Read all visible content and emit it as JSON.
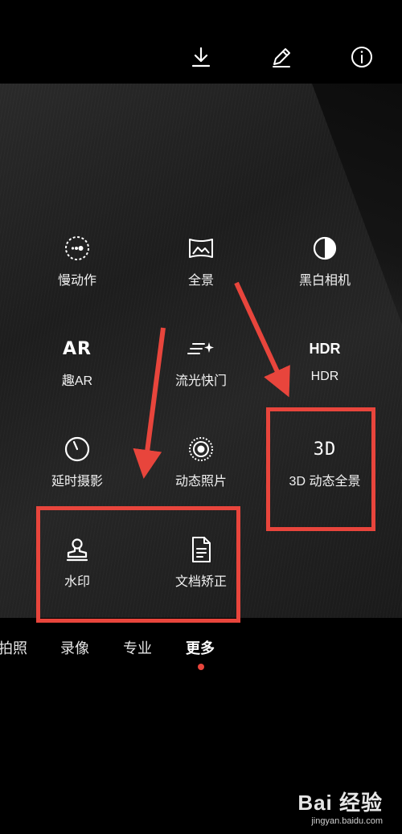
{
  "toolbar": {
    "icons": [
      "download-icon",
      "edit-icon",
      "info-icon"
    ]
  },
  "modes": {
    "slow_motion": "慢动作",
    "panorama": "全景",
    "monochrome": "黑白相机",
    "ar": "趣AR",
    "light_painting": "流光快门",
    "hdr": "HDR",
    "hdr_icon_text": "HDR",
    "time_lapse": "延时摄影",
    "moving_picture": "动态照片",
    "panorama_3d": "3D 动态全景",
    "panorama_3d_icon_text": "3D",
    "watermark": "水印",
    "document": "文档矫正",
    "ar_icon_text": "AR"
  },
  "tabs": [
    "拍照",
    "录像",
    "专业",
    "更多"
  ],
  "active_tab": "更多",
  "colors": {
    "annotation_red": "#e8453c",
    "background": "#000000"
  },
  "site_watermark": {
    "brand": "Bai 经验",
    "url": "jingyan.baidu.com"
  }
}
